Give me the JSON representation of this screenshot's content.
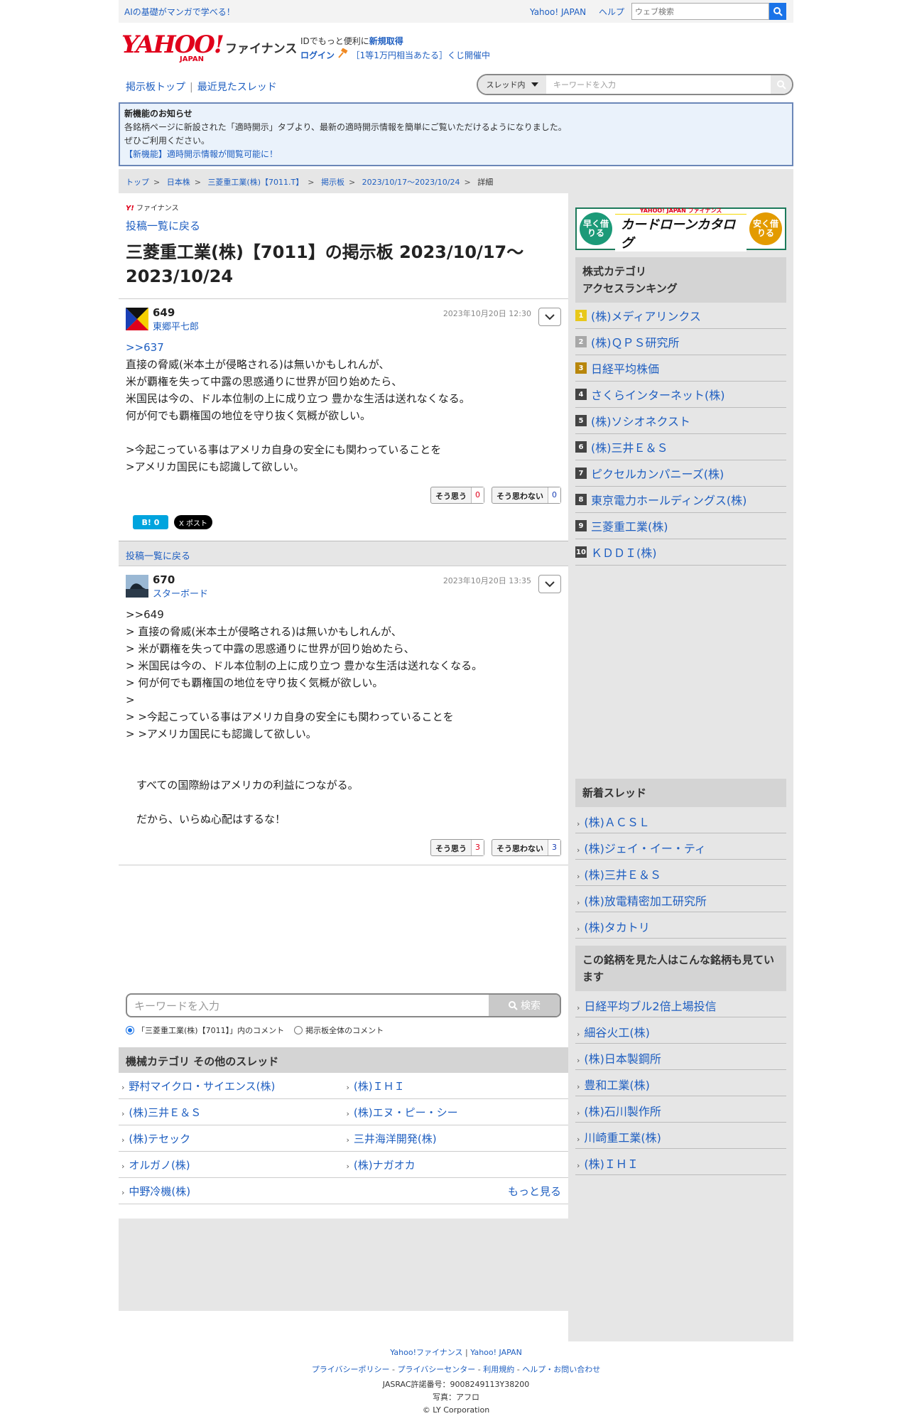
{
  "topbar": {
    "promo": "AIの基礎がマンガで学べる！",
    "links": [
      "Yahoo! JAPAN",
      "ヘルプ"
    ],
    "search_placeholder": "ウェブ検索"
  },
  "header": {
    "logo_yahoo": "YAHOO!",
    "logo_japan": "JAPAN",
    "logo_finance": "ファイナンス",
    "id_text": "IDでもっと便利に",
    "register": "新規取得",
    "login": "ログイン",
    "lottery": "［1等1万円相当あたる］くじ開催中"
  },
  "nav": {
    "board_top": "掲示板トップ",
    "recent": "最近見たスレッド",
    "scope": "スレッド内",
    "search_placeholder": "キーワードを入力"
  },
  "notice": {
    "title": "新機能のお知らせ",
    "line1": "各銘柄ページに新設された「適時開示」タブより、最新の適時開示情報を簡単にご覧いただけるようになりました。",
    "line2": "ぜひご利用ください。",
    "link": "【新機能】適時開示情報が閲覧可能に！"
  },
  "breadcrumb": [
    "トップ",
    "日本株",
    "三菱重工業(株)【7011.T】",
    "掲示板",
    "2023/10/17〜2023/10/24",
    "詳細"
  ],
  "main": {
    "yfin_label": "ファイナンス",
    "back": "投稿一覧に戻る",
    "title": "三菱重工業(株)【7011】の掲示板 2023/10/17〜2023/10/24"
  },
  "posts": [
    {
      "number": "649",
      "user": "東郷平七郎",
      "date": "2023年10月20日 12:30",
      "reply": ">>637",
      "body": "直接の脅威(米本土が侵略される)は無いかもしれんが、\n米が覇権を失って中露の思惑通りに世界が回り始めたら、\n米国民は今の、ドル本位制の上に成り立つ 豊かな生活は送れなくなる。\n何が何でも覇権国の地位を守り抜く気概が欲しい。\n\n>今起こっている事はアメリカ自身の安全にも関わっていることを\n>アメリカ国民にも認識して欲しい。",
      "agree_label": "そう思う",
      "agree": "0",
      "disagree_label": "そう思わない",
      "disagree": "0",
      "hatena": "B! 0",
      "x_post": "X ポスト"
    },
    {
      "number": "670",
      "user": "スターボード",
      "date": "2023年10月20日 13:35",
      "reply": "",
      "body": ">>649\n> 直接の脅威(米本土が侵略される)は無いかもしれんが、\n> 米が覇権を失って中露の思惑通りに世界が回り始めたら、\n> 米国民は今の、ドル本位制の上に成り立つ 豊かな生活は送れなくなる。\n> 何が何でも覇権国の地位を守り抜く気概が欲しい。\n>\n> >今起こっている事はアメリカ自身の安全にも関わっていることを\n> >アメリカ国民にも認識して欲しい。\n\n\n　すべての国際紛はアメリカの利益につながる。\n\n　だから、いらぬ心配はするな！",
      "agree_label": "そう思う",
      "agree": "3",
      "disagree_label": "そう思わない",
      "disagree": "3"
    }
  ],
  "back2": "投稿一覧に戻る",
  "comment_search": {
    "placeholder": "キーワードを入力",
    "button": "検索",
    "opt1": "「三菱重工業(株)【7011】」内のコメント",
    "opt2": "掲示板全体のコメント"
  },
  "category": {
    "title": "機械カテゴリ その他のスレッド",
    "items": [
      "野村マイクロ・サイエンス(株)",
      "(株)ＩＨＩ",
      "(株)三井Ｅ＆Ｓ",
      "(株)エヌ・ピー・シー",
      "(株)テセック",
      "三井海洋開発(株)",
      "オルガノ(株)",
      "(株)ナガオカ",
      "中野冷機(株)"
    ],
    "more": "もっと見る"
  },
  "sidebar": {
    "banner": {
      "left": "早く借りる",
      "yahoo": "YAHOO! JAPAN ファイナンス",
      "title": "カードローンカタログ",
      "right": "安く借りる"
    },
    "ranking_title": "株式カテゴリ\nアクセスランキング",
    "ranking": [
      {
        "rank": "1",
        "name": "(株)メディアリンクス",
        "color": "#e8c81a"
      },
      {
        "rank": "2",
        "name": "(株)ＱＰＳ研究所",
        "color": "#a8a8a8"
      },
      {
        "rank": "3",
        "name": "日経平均株価",
        "color": "#b8860b"
      },
      {
        "rank": "4",
        "name": "さくらインターネット(株)",
        "color": "#444444"
      },
      {
        "rank": "5",
        "name": "(株)ソシオネクスト",
        "color": "#444444"
      },
      {
        "rank": "6",
        "name": "(株)三井Ｅ＆Ｓ",
        "color": "#444444"
      },
      {
        "rank": "7",
        "name": "ピクセルカンパニーズ(株)",
        "color": "#444444"
      },
      {
        "rank": "8",
        "name": "東京電力ホールディングス(株)",
        "color": "#444444"
      },
      {
        "rank": "9",
        "name": "三菱重工業(株)",
        "color": "#444444"
      },
      {
        "rank": "10",
        "name": "ＫＤＤＩ(株)",
        "color": "#444444"
      }
    ],
    "new_threads_title": "新着スレッド",
    "new_threads": [
      "(株)ＡＣＳＬ",
      "(株)ジェイ・イー・ティ",
      "(株)三井Ｅ＆Ｓ",
      "(株)放電精密加工研究所",
      "(株)タカトリ"
    ],
    "related_title": "この銘柄を見た人はこんな銘柄も見ています",
    "related": [
      "日経平均ブル2倍上場投信",
      "細谷火工(株)",
      "(株)日本製鋼所",
      "豊和工業(株)",
      "(株)石川製作所",
      "川崎重工業(株)",
      "(株)ＩＨＩ"
    ]
  },
  "footer": {
    "row1": [
      "Yahoo!ファイナンス",
      "Yahoo! JAPAN"
    ],
    "row2": [
      "プライバシーポリシー",
      "プライバシーセンター",
      "利用規約",
      "ヘルプ・お問い合わせ"
    ],
    "jasrac": "JASRAC許諾番号：9008249113Y38200",
    "photo": "写真：アフロ",
    "copyright": "© LY Corporation"
  }
}
